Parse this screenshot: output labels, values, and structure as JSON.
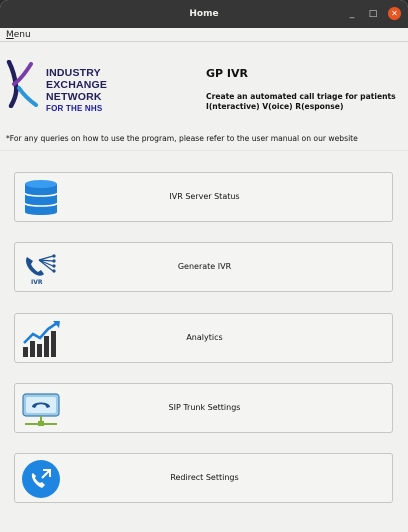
{
  "window": {
    "title": "Home",
    "controls": {
      "minimize": "_",
      "maximize": "□",
      "close": "✕"
    }
  },
  "menubar": {
    "menu_first": "M",
    "menu_rest": "enu"
  },
  "logo": {
    "line1": "INDUSTRY",
    "line2": "EXCHANGE",
    "line3": "NETWORK",
    "line4": "FOR THE NHS"
  },
  "header": {
    "title": "GP IVR",
    "desc_line1": "Create an automated call triage for patients",
    "desc_line2": "I(nteractive) V(oice) R(esponse)"
  },
  "notice": "*For any queries on how to use the program, please refer to the user manual on our website",
  "buttons": [
    {
      "label": "IVR Server Status",
      "icon": "database-icon"
    },
    {
      "label": "Generate IVR",
      "icon": "ivr-phone-icon",
      "icon_text": "IVR"
    },
    {
      "label": "Analytics",
      "icon": "bar-chart-icon"
    },
    {
      "label": "SIP Trunk Settings",
      "icon": "sip-phone-icon"
    },
    {
      "label": "Redirect Settings",
      "icon": "call-redirect-icon"
    }
  ],
  "colors": {
    "titlebar": "#363636",
    "close": "#e95420",
    "logo_text": "#22205b",
    "database": "#1f7fd6",
    "chart": "#1f7fd6"
  }
}
